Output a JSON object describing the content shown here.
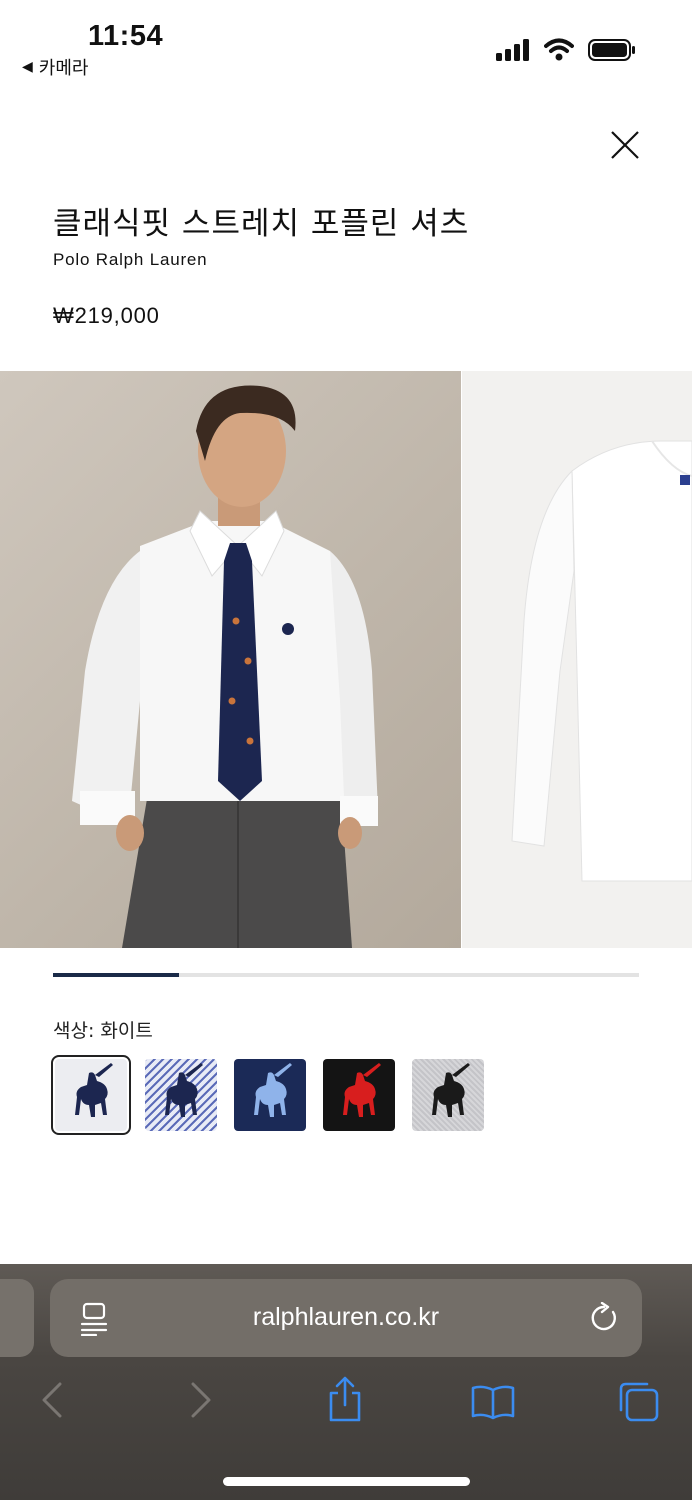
{
  "status_bar": {
    "time": "11:54",
    "back_label": "카메라",
    "icons": [
      "cellular-signal-icon",
      "wifi-icon",
      "battery-icon"
    ]
  },
  "product": {
    "title": "클래식핏 스트레치 포플린 셔츠",
    "brand": "Polo Ralph Lauren",
    "price": "₩219,000"
  },
  "gallery": {
    "images": [
      "model-wearing-shirt-with-tie",
      "shirt-flat-front"
    ],
    "progress_fraction": 0.215
  },
  "color": {
    "label": "색상:",
    "selected": "화이트",
    "swatches": [
      {
        "name": "white",
        "bg": "#ecedf1",
        "logo": "#1c2650"
      },
      {
        "name": "blue-stripe",
        "bg": "#b8c0e0",
        "logo": "#1c2650"
      },
      {
        "name": "navy",
        "bg": "#1b2a57",
        "logo": "#8fb3ea"
      },
      {
        "name": "black",
        "bg": "#141414",
        "logo": "#d81e1e"
      },
      {
        "name": "grey",
        "bg": "#c9c9cc",
        "logo": "#1a1a1a"
      }
    ]
  },
  "browser": {
    "url": "ralphlauren.co.kr",
    "toolbar": [
      "back-icon",
      "forward-icon",
      "share-icon",
      "bookmarks-icon",
      "tabs-icon"
    ],
    "accent": "#3b8cf0"
  }
}
